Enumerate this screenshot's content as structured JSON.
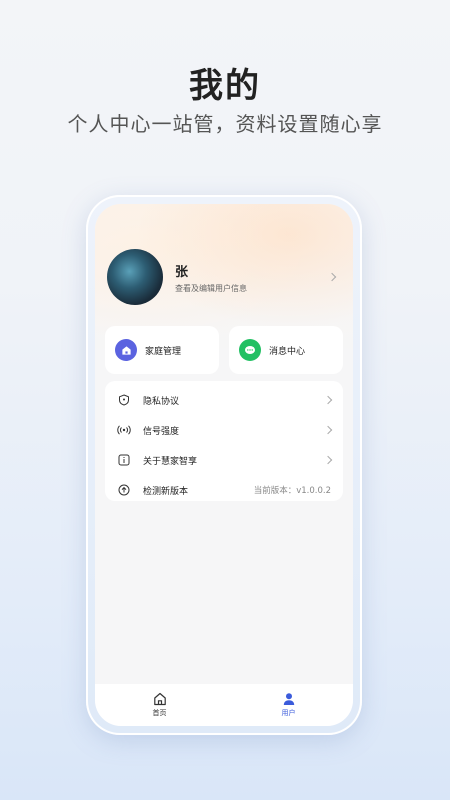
{
  "hero": {
    "title": "我的",
    "subtitle": "个人中心一站管，资料设置随心享"
  },
  "profile": {
    "name": "张",
    "hint": "查看及编辑用户信息"
  },
  "quick_actions": [
    {
      "label": "家庭管理",
      "icon": "home-icon",
      "color": "#5b63e0"
    },
    {
      "label": "消息中心",
      "icon": "chat-icon",
      "color": "#22c063"
    }
  ],
  "menu": [
    {
      "label": "隐私协议",
      "icon": "shield-icon",
      "value": ""
    },
    {
      "label": "信号强度",
      "icon": "signal-icon",
      "value": ""
    },
    {
      "label": "关于慧家智享",
      "icon": "info-icon",
      "value": ""
    },
    {
      "label": "检测新版本",
      "icon": "upload-icon",
      "value": "当前版本：v1.0.0.2"
    }
  ],
  "tabbar": [
    {
      "label": "首页",
      "icon": "home-tab-icon",
      "active": false
    },
    {
      "label": "用户",
      "icon": "user-tab-icon",
      "active": true
    }
  ],
  "colors": {
    "accent": "#3b5bdb",
    "home_icon_bg": "#5b63e0",
    "message_icon_bg": "#22c063"
  }
}
